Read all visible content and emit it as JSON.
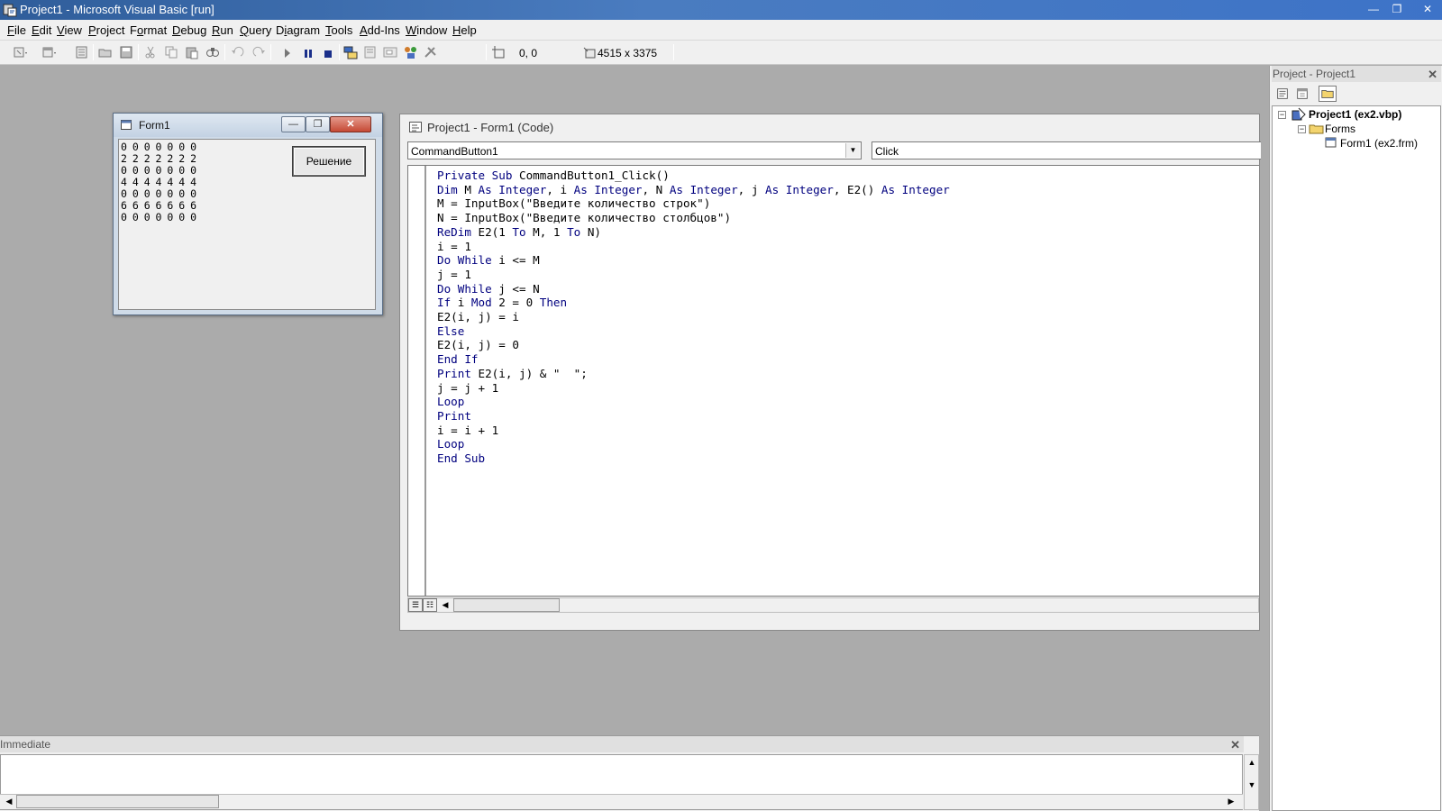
{
  "window": {
    "title": "Project1 - Microsoft Visual Basic [run]",
    "minimize": "—",
    "restore": "❐",
    "close": "✕"
  },
  "menu": [
    {
      "ul": "F",
      "rest": "ile"
    },
    {
      "ul": "E",
      "rest": "dit"
    },
    {
      "ul": "V",
      "rest": "iew"
    },
    {
      "ul": "P",
      "rest": "roject"
    },
    {
      "ul": "",
      "pre": "F",
      "ulmid": "o",
      "rest": "rmat"
    },
    {
      "ul": "D",
      "rest": "ebug"
    },
    {
      "ul": "R",
      "rest": "un"
    },
    {
      "ul": "Q",
      "rest": "uery"
    },
    {
      "ul": "",
      "pre": "D",
      "ulmid": "i",
      "rest": "agram"
    },
    {
      "ul": "T",
      "rest": "ools"
    },
    {
      "ul": "A",
      "rest": "dd-Ins"
    },
    {
      "ul": "W",
      "rest": "indow"
    },
    {
      "ul": "H",
      "rest": "elp"
    }
  ],
  "toolbar": {
    "position": "0, 0",
    "size": "4515 x 3375"
  },
  "form1": {
    "title": "Form1",
    "button_label": "Решение",
    "output_lines": [
      "0 0 0 0 0 0 0",
      "2 2 2 2 2 2 2",
      "0 0 0 0 0 0 0",
      "4 4 4 4 4 4 4",
      "0 0 0 0 0 0 0",
      "6 6 6 6 6 6 6",
      "0 0 0 0 0 0 0"
    ]
  },
  "code_window": {
    "title": "Project1 - Form1 (Code)",
    "object_combo": "CommandButton1",
    "procedure_combo": "Click",
    "lines": [
      [
        [
          "kw",
          "Private Sub"
        ],
        [
          "t",
          " CommandButton1_Click()"
        ]
      ],
      [
        [
          "kw",
          "Dim"
        ],
        [
          "t",
          " M "
        ],
        [
          "kw",
          "As Integer"
        ],
        [
          "t",
          ", i "
        ],
        [
          "kw",
          "As Integer"
        ],
        [
          "t",
          ", N "
        ],
        [
          "kw",
          "As Integer"
        ],
        [
          "t",
          ", j "
        ],
        [
          "kw",
          "As Integer"
        ],
        [
          "t",
          ", E2() "
        ],
        [
          "kw",
          "As Integer"
        ]
      ],
      [
        [
          "t",
          "M = InputBox(\"Введите количество строк\")"
        ]
      ],
      [
        [
          "t",
          "N = InputBox(\"Введите количество столбцов\")"
        ]
      ],
      [
        [
          "kw",
          "ReDim"
        ],
        [
          "t",
          " E2(1 "
        ],
        [
          "kw",
          "To"
        ],
        [
          "t",
          " M, 1 "
        ],
        [
          "kw",
          "To"
        ],
        [
          "t",
          " N)"
        ]
      ],
      [
        [
          "t",
          "i = 1"
        ]
      ],
      [
        [
          "kw",
          "Do While"
        ],
        [
          "t",
          " i <= M"
        ]
      ],
      [
        [
          "t",
          "j = 1"
        ]
      ],
      [
        [
          "kw",
          "Do While"
        ],
        [
          "t",
          " j <= N"
        ]
      ],
      [
        [
          "kw",
          "If"
        ],
        [
          "t",
          " i "
        ],
        [
          "kw",
          "Mod"
        ],
        [
          "t",
          " 2 = 0 "
        ],
        [
          "kw",
          "Then"
        ]
      ],
      [
        [
          "t",
          "E2(i, j) = i"
        ]
      ],
      [
        [
          "kw",
          "Else"
        ]
      ],
      [
        [
          "t",
          "E2(i, j) = 0"
        ]
      ],
      [
        [
          "kw",
          "End If"
        ]
      ],
      [
        [
          "kw",
          "Print"
        ],
        [
          "t",
          " E2(i, j) & \"  \";"
        ]
      ],
      [
        [
          "t",
          "j = j + 1"
        ]
      ],
      [
        [
          "kw",
          "Loop"
        ]
      ],
      [
        [
          "kw",
          "Print"
        ]
      ],
      [
        [
          "t",
          "i = i + 1"
        ]
      ],
      [
        [
          "kw",
          "Loop"
        ]
      ],
      [
        [
          "kw",
          "End Sub"
        ]
      ]
    ]
  },
  "project_panel": {
    "title": "Project - Project1",
    "close": "✕",
    "root": "Project1 (ex2.vbp)",
    "folder": "Forms",
    "item": "Form1 (ex2.frm)"
  },
  "immediate": {
    "title": "Immediate",
    "close": "✕"
  },
  "colors": {
    "keyword": "#00007f",
    "titlebar": "#3d73c8",
    "mdi_background": "#ababab"
  }
}
